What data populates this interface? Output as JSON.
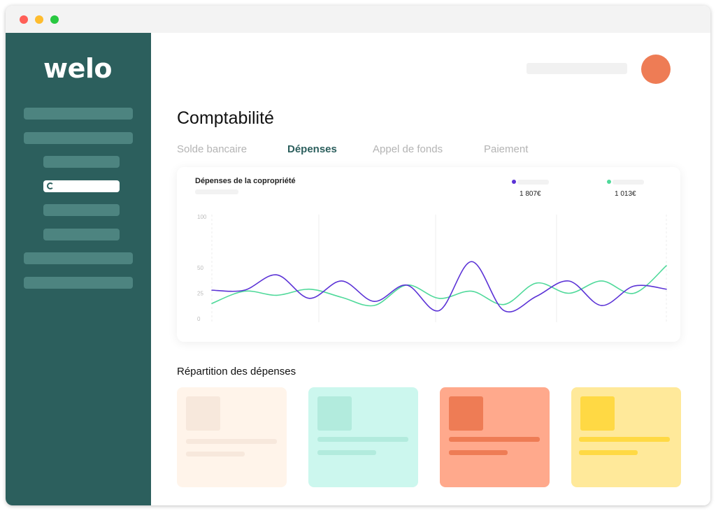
{
  "window": {
    "controls": [
      {
        "name": "close",
        "color": "#ff5f57"
      },
      {
        "name": "minimize",
        "color": "#febc2e"
      },
      {
        "name": "maximize",
        "color": "#28c840"
      }
    ]
  },
  "sidebar": {
    "logo": "welo",
    "background": "#2c5f5d",
    "item_count": 8,
    "active_item": 3
  },
  "header": {
    "avatar_color": "#ee7c55"
  },
  "page": {
    "title": "Comptabilité",
    "tabs": [
      {
        "label": "Solde bancaire",
        "active": false
      },
      {
        "label": "Dépenses",
        "active": true
      },
      {
        "label": "Appel de fonds",
        "active": false
      },
      {
        "label": "Paiement",
        "active": false
      }
    ]
  },
  "chart_card": {
    "title": "Dépenses de la copropriété",
    "legend": [
      {
        "value": "1 807€",
        "color": "#5b32d6"
      },
      {
        "value": "1 013€",
        "color": "#4fd99a"
      }
    ]
  },
  "chart_data": {
    "type": "line",
    "y_ticks": [
      "100",
      "50",
      "25",
      "0"
    ],
    "ylim": [
      0,
      100
    ],
    "x": [
      0,
      1,
      2,
      3,
      4,
      5,
      6,
      7,
      8,
      9,
      10,
      11,
      12,
      13,
      14
    ],
    "series": [
      {
        "color": "#5b32d6",
        "values": [
          28,
          28,
          43,
          20,
          37,
          17,
          33,
          8,
          56,
          8,
          22,
          37,
          13,
          32,
          29
        ]
      },
      {
        "color": "#4fd99a",
        "values": [
          15,
          27,
          23,
          29,
          21,
          13,
          33,
          20,
          27,
          14,
          35,
          25,
          37,
          25,
          52
        ]
      }
    ],
    "grid": "vertical",
    "legend_position": "top-right"
  },
  "distribution": {
    "title": "Répartition des dépenses",
    "cards": [
      {
        "bg": "#fff4ea",
        "accent": "#f7e8dc"
      },
      {
        "bg": "#ccf7ee",
        "accent": "#b2ebdd"
      },
      {
        "bg": "#ffa98c",
        "accent": "#ee7c55"
      },
      {
        "bg": "#ffe99a",
        "accent": "#ffd944"
      }
    ]
  }
}
